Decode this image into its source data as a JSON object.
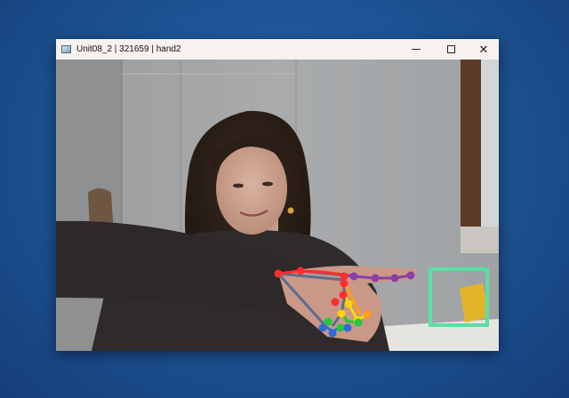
{
  "window": {
    "title": "Unit08_2 | 321659 | hand2",
    "controls": {
      "minimize": "minimize",
      "maximize": "maximize",
      "close_glyph": "✕"
    }
  },
  "camera_feed": {
    "scene": "webcam",
    "overlay": {
      "hand_landmarks_detected": true,
      "finger_colors": {
        "palm": "#5b6b8f",
        "thumb": "#ff2e2e",
        "index": "#8a3fa8",
        "middle": "#ffd400",
        "ring": "#22c93b",
        "pinky": "#2f6bd8"
      },
      "target_box_color": "#59e0a4"
    }
  }
}
